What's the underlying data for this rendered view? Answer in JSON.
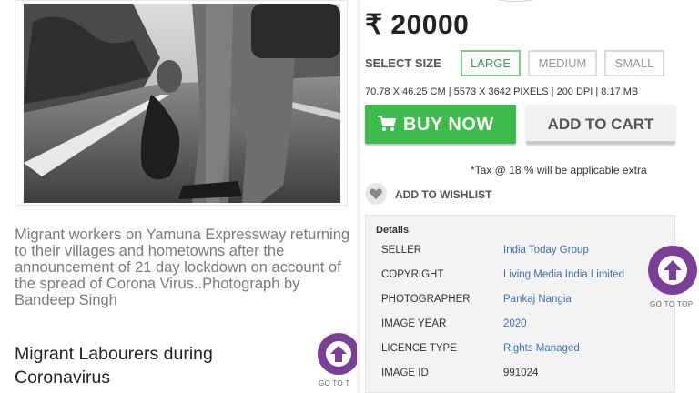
{
  "left": {
    "caption": "Migrant workers on Yamuna Expressway returning to their villages and hometowns after the announcement of 21 day lockdown on account of the spread of Corona Virus..Photograph by Bandeep Singh",
    "title": "Migrant Labourers during Coronavirus",
    "go_to_top_label": "GO TO T"
  },
  "product": {
    "price": "₹ 20000",
    "select_size_label": "SELECT SIZE",
    "sizes": [
      {
        "label": "LARGE",
        "selected": true
      },
      {
        "label": "MEDIUM",
        "selected": false
      },
      {
        "label": "SMALL",
        "selected": false
      }
    ],
    "dimensions": "70.78 X 46.25 CM | 5573 X 3642 PIXELS | 200 DPI | 8.17 MB",
    "buy_now_label": "BUY NOW",
    "add_to_cart_label": "ADD TO CART",
    "tax_note": "*Tax @ 18 % will be applicable extra",
    "wishlist_label": "ADD TO WISHLIST"
  },
  "details": {
    "heading": "Details",
    "rows": [
      {
        "key": "SELLER",
        "value": "India Today Group"
      },
      {
        "key": "COPYRIGHT",
        "value": "Living Media India Limited"
      },
      {
        "key": "PHOTOGRAPHER",
        "value": "Pankaj Nangia"
      },
      {
        "key": "IMAGE YEAR",
        "value": "2020"
      },
      {
        "key": "LICENCE TYPE",
        "value": "Rights Managed"
      },
      {
        "key": "IMAGE ID",
        "value": "991024"
      }
    ]
  },
  "right": {
    "go_to_top_label": "GO TO TOP"
  },
  "icons": {
    "cart": "shopping-cart-icon",
    "heart": "heart-icon",
    "arrow_up": "arrow-up-icon"
  },
  "colors": {
    "buy_green": "#3dbb4b",
    "fab_purple": "#7b3f98",
    "link_blue": "#3a73b5",
    "selected_size_green": "#3f9b4c"
  }
}
